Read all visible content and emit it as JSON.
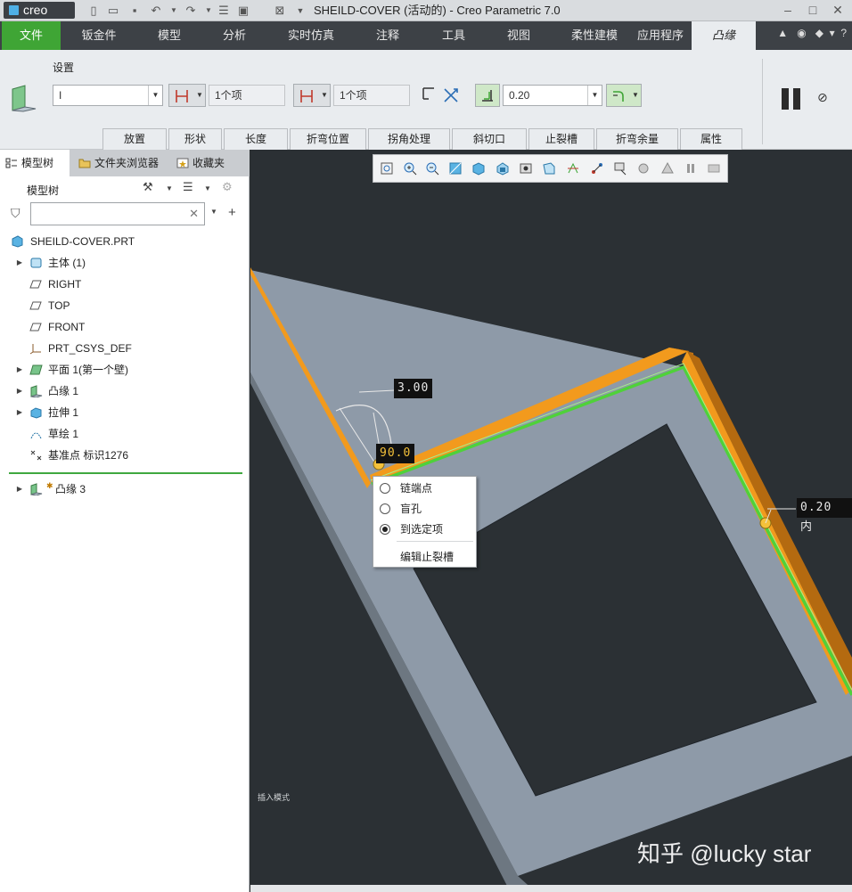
{
  "window": {
    "logo_text": "creo",
    "title": "SHEILD-COVER (活动的) - Creo Parametric 7.0",
    "controls": [
      "–",
      "□",
      "✕"
    ]
  },
  "ribbon_tabs": [
    {
      "label": "文件"
    },
    {
      "label": "钣金件"
    },
    {
      "label": "模型"
    },
    {
      "label": "分析"
    },
    {
      "label": "实时仿真"
    },
    {
      "label": "注释"
    },
    {
      "label": "工具"
    },
    {
      "label": "视图"
    },
    {
      "label": "柔性建模"
    },
    {
      "label": "应用程序"
    },
    {
      "label": "凸缘"
    }
  ],
  "ribbon": {
    "settings_label": "设置",
    "shape_combo_value": "I",
    "ref1_value": "1个项",
    "ref2_value": "1个项",
    "thickness_value": "0.20",
    "sub_tabs": [
      "放置",
      "形状",
      "长度",
      "折弯位置",
      "拐角处理",
      "斜切口",
      "止裂槽",
      "折弯余量",
      "属性"
    ]
  },
  "left_panel": {
    "tabs": [
      "模型树",
      "文件夹浏览器",
      "收藏夹"
    ],
    "tree_title": "模型树",
    "filter_placeholder": "",
    "tree": [
      {
        "label": "SHEILD-COVER.PRT",
        "icon": "part-icon"
      },
      {
        "label": "主体 (1)",
        "icon": "body-icon"
      },
      {
        "label": "RIGHT",
        "icon": "plane-icon"
      },
      {
        "label": "TOP",
        "icon": "plane-icon"
      },
      {
        "label": "FRONT",
        "icon": "plane-icon"
      },
      {
        "label": "PRT_CSYS_DEF",
        "icon": "csys-icon"
      },
      {
        "label": "平面 1(第一个壁)",
        "icon": "planar-wall-icon"
      },
      {
        "label": "凸缘 1",
        "icon": "flange-icon"
      },
      {
        "label": "拉伸 1",
        "icon": "extrude-icon"
      },
      {
        "label": "草绘 1",
        "icon": "sketch-icon"
      },
      {
        "label": "基准点 标识1276",
        "icon": "datum-point-icon"
      },
      {
        "label": "凸缘 3",
        "icon": "flange-icon"
      }
    ]
  },
  "viewport": {
    "dimensions": {
      "length": "3.00",
      "angle": "90.0",
      "thickness": "0.20 内"
    },
    "context_menu": [
      "链端点",
      "盲孔",
      "到选定项",
      "编辑止裂槽"
    ],
    "selected_option": "到选定项",
    "status_small": "插入模式",
    "watermark": "知乎 @lucky star"
  },
  "colors": {
    "file_tab": "#3fa535",
    "flange": "#f29a1d",
    "edge_highlight": "#4fd13a",
    "plate": "#8e9aa8",
    "background": "#2b3034"
  }
}
